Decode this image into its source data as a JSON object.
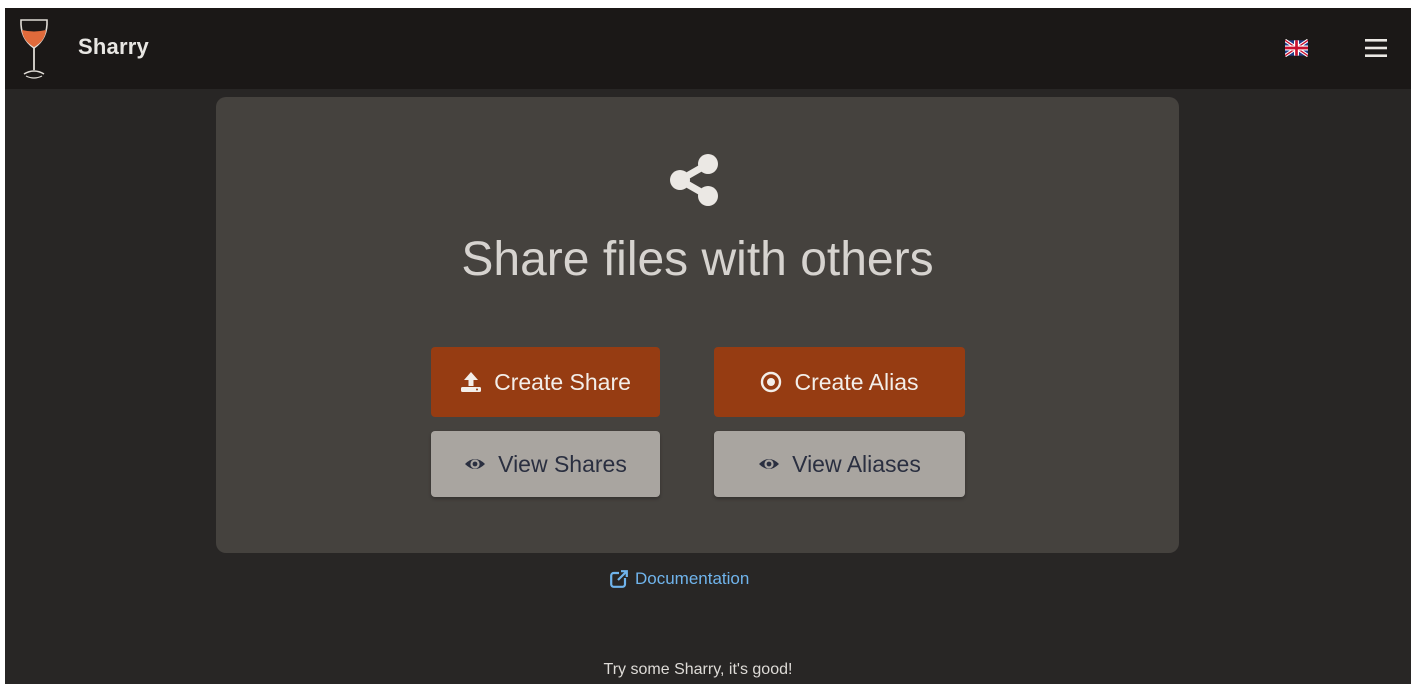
{
  "app": {
    "brand": "Sharry"
  },
  "header": {
    "language_icon": "uk-flag-icon",
    "menu_icon": "hamburger-menu-icon"
  },
  "hero": {
    "icon": "share-icon",
    "title": "Share files with others"
  },
  "actions": {
    "create_share": {
      "label": "Create Share",
      "icon": "upload-icon"
    },
    "create_alias": {
      "label": "Create Alias",
      "icon": "dot-circle-icon"
    },
    "view_shares": {
      "label": "View Shares",
      "icon": "eye-icon"
    },
    "view_aliases": {
      "label": "View Aliases",
      "icon": "eye-icon"
    }
  },
  "links": {
    "documentation": "Documentation"
  },
  "footer": {
    "text": "Try some Sharry, it's good!"
  },
  "colors": {
    "background": "#282625",
    "topbar": "#1b1817",
    "card": "#45423e",
    "primary_button": "#963c12",
    "secondary_button": "#a9a5a0",
    "link": "#70b4ec"
  }
}
